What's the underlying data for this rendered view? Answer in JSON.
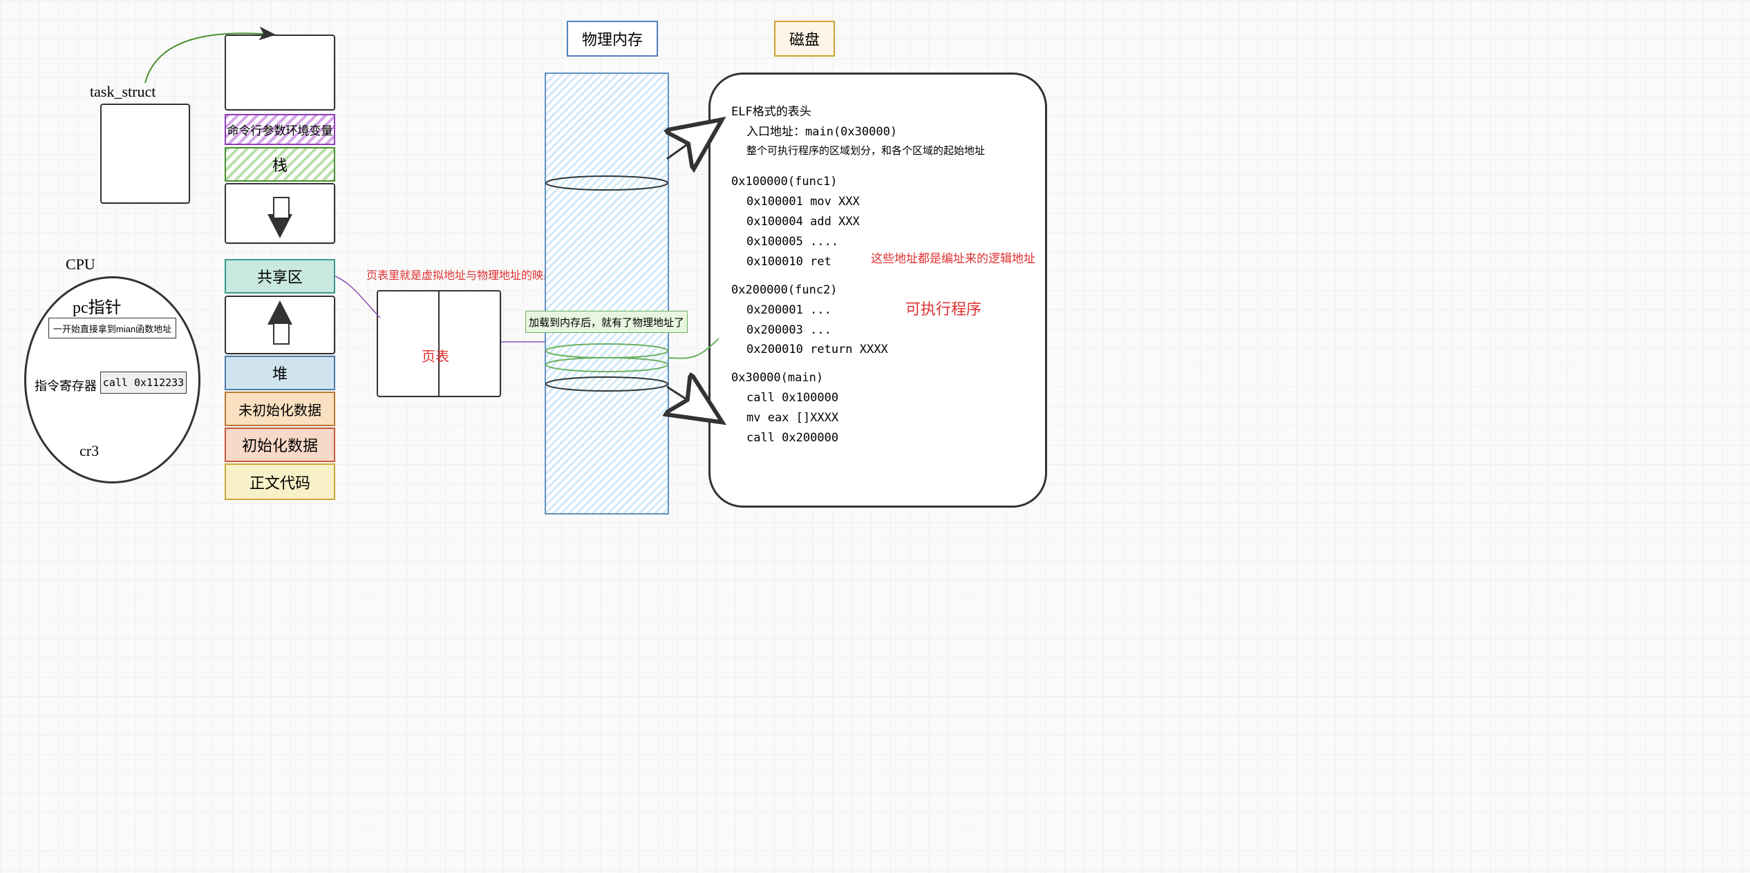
{
  "task_struct_label": "task_struct",
  "cpu": {
    "title": "CPU",
    "pc_label": "pc指针",
    "pc_note": "一开始直接拿到mian函数地址",
    "ir_label": "指令寄存器",
    "ir_value": "call 0x112233",
    "cr3_label": "cr3"
  },
  "vmem": {
    "cmdline_env": "命令行参数环境变量",
    "stack": "栈",
    "shared": "共享区",
    "heap": "堆",
    "bss": "未初始化数据",
    "data": "初始化数据",
    "text": "正文代码"
  },
  "page_table": {
    "note": "页表里就是虚拟地址与物理地址的映射",
    "title": "页表"
  },
  "physmem": {
    "header": "物理内存",
    "note": "加载到内存后，就有了物理地址了"
  },
  "disk": {
    "header": "磁盘",
    "elf_header": "ELF格式的表头",
    "entry": "入口地址：main(0x30000)",
    "layout": "整个可执行程序的区域划分，和各个区域的起始地址",
    "func1_head": "0x100000(func1)",
    "func1_l1": "0x100001 mov XXX",
    "func1_l2": "0x100004 add XXX",
    "func1_l3": "0x100005 ....",
    "func1_l4": "0x100010 ret",
    "note_logical": "这些地址都是编址来的逻辑地址",
    "note_exec": "可执行程序",
    "func2_head": "0x200000(func2)",
    "func2_l1": "0x200001 ...",
    "func2_l2": "0x200003 ...",
    "func2_l3": "0x200010 return XXXX",
    "main_head": "0x30000(main)",
    "main_l1": "call 0x100000",
    "main_l2": "mv eax []XXXX",
    "main_l3": "call 0x200000"
  }
}
